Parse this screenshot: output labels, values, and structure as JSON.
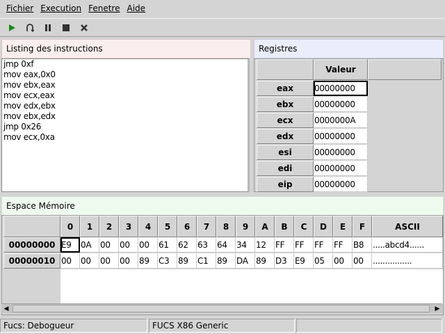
{
  "menu": {
    "items": [
      {
        "label": "Fichier"
      },
      {
        "label": "Execution"
      },
      {
        "label": "Fenetre"
      },
      {
        "label": "Aide"
      }
    ]
  },
  "toolbar": {
    "buttons": [
      {
        "icon": "play-icon",
        "color": "#1a8a1a"
      },
      {
        "icon": "step-icon",
        "color": "#333333"
      },
      {
        "icon": "pause-icon",
        "color": "#333333"
      },
      {
        "icon": "stop-icon",
        "color": "#333333"
      },
      {
        "icon": "close-x-icon",
        "color": "#333333"
      }
    ]
  },
  "listing": {
    "title": "Listing des instructions",
    "lines": [
      "jmp 0xf",
      "mov eax,0x0",
      "mov ebx,eax",
      "mov ecx,eax",
      "mov edx,ebx",
      "mov ebx,edx",
      "jmp 0x26",
      "mov ecx,0xa"
    ]
  },
  "registers": {
    "title": "Registres",
    "column_header": "Valeur",
    "rows": [
      {
        "name": "eax",
        "value": "00000000"
      },
      {
        "name": "ebx",
        "value": "00000000"
      },
      {
        "name": "ecx",
        "value": "0000000A"
      },
      {
        "name": "edx",
        "value": "00000000"
      },
      {
        "name": "esi",
        "value": "00000000"
      },
      {
        "name": "edi",
        "value": "00000000"
      },
      {
        "name": "eip",
        "value": "00000000"
      }
    ]
  },
  "memory": {
    "title": "Espace Mémoire",
    "columns": [
      "0",
      "1",
      "2",
      "3",
      "4",
      "5",
      "6",
      "7",
      "8",
      "9",
      "A",
      "B",
      "C",
      "D",
      "E",
      "F"
    ],
    "ascii_header": "ASCII",
    "rows": [
      {
        "address": "00000000",
        "bytes": [
          "E9",
          "0A",
          "00",
          "00",
          "00",
          "61",
          "62",
          "63",
          "64",
          "34",
          "12",
          "FF",
          "FF",
          "FF",
          "FF",
          "B8"
        ],
        "ascii": ".....abcd4......"
      },
      {
        "address": "00000010",
        "bytes": [
          "00",
          "00",
          "00",
          "00",
          "89",
          "C3",
          "89",
          "C1",
          "89",
          "DA",
          "89",
          "D3",
          "E9",
          "05",
          "00",
          "00"
        ],
        "ascii": "................"
      }
    ]
  },
  "status": {
    "left": "Fucs:  Debogueur",
    "middle": "FUCS X86 Generic",
    "right": ""
  }
}
